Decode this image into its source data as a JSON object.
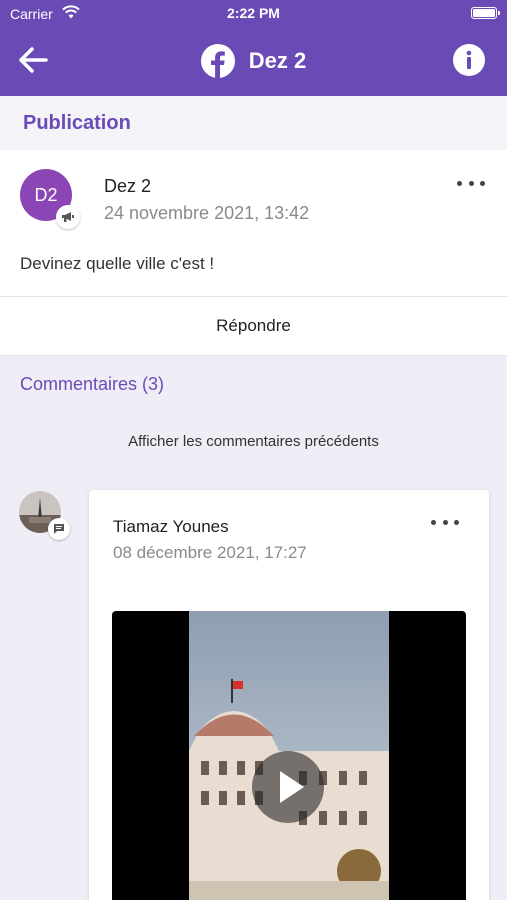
{
  "status_bar": {
    "carrier": "Carrier",
    "time": "2:22 PM"
  },
  "nav": {
    "title": "Dez 2",
    "back_icon": "back-arrow-icon",
    "logo_icon": "facebook-icon",
    "info_icon": "info-icon"
  },
  "publication": {
    "header": "Publication",
    "avatar_initials": "D2",
    "author": "Dez 2",
    "date": "24 novembre 2021, 13:42",
    "text": "Devinez quelle ville c'est !",
    "reply_label": "Répondre"
  },
  "comments": {
    "title": "Commentaires (3)",
    "show_previous": "Afficher les commentaires précédents",
    "items": [
      {
        "author": "Tiamaz Younes",
        "date": "08 décembre 2021, 17:27",
        "media": "video"
      }
    ]
  },
  "colors": {
    "accent": "#6a4bb6",
    "avatar": "#8b45b4"
  }
}
